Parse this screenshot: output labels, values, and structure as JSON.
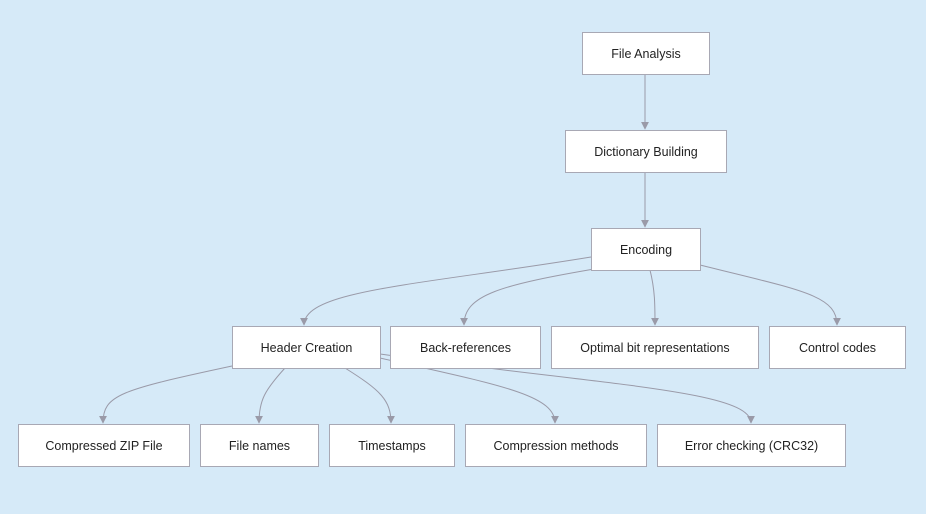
{
  "nodes": {
    "file_analysis": "File Analysis",
    "dictionary_building": "Dictionary Building",
    "encoding": "Encoding",
    "header_creation": "Header Creation",
    "back_references": "Back-references",
    "optimal_bit": "Optimal bit representations",
    "control_codes": "Control codes",
    "compressed_zip": "Compressed ZIP File",
    "file_names": "File names",
    "timestamps": "Timestamps",
    "compression_methods": "Compression methods",
    "error_checking": "Error checking (CRC32)"
  },
  "edges": [
    [
      "file_analysis",
      "dictionary_building"
    ],
    [
      "dictionary_building",
      "encoding"
    ],
    [
      "encoding",
      "header_creation"
    ],
    [
      "encoding",
      "back_references"
    ],
    [
      "encoding",
      "optimal_bit"
    ],
    [
      "encoding",
      "control_codes"
    ],
    [
      "header_creation",
      "compressed_zip"
    ],
    [
      "header_creation",
      "file_names"
    ],
    [
      "header_creation",
      "timestamps"
    ],
    [
      "header_creation",
      "compression_methods"
    ],
    [
      "header_creation",
      "error_checking"
    ]
  ],
  "colors": {
    "background": "#d6eaf8",
    "node_fill": "#ffffff",
    "node_border": "#a8a8b4",
    "edge": "#9a9aa8"
  }
}
